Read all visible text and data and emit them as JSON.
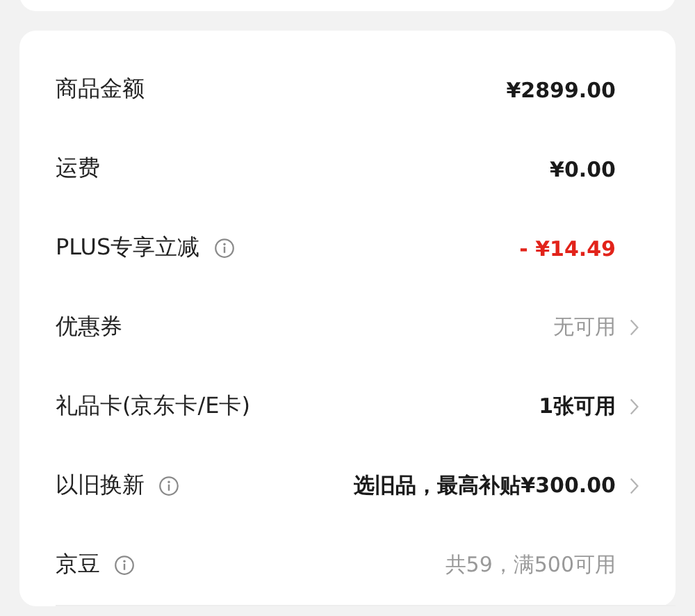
{
  "rows": [
    {
      "label": "商品金额",
      "info": false,
      "value": "¥2899.00",
      "kind": "normal",
      "chevron": false
    },
    {
      "label": "运费",
      "info": false,
      "value": "¥0.00",
      "kind": "normal",
      "chevron": false
    },
    {
      "label": "PLUS专享立减",
      "info": true,
      "value": "- ¥14.49",
      "kind": "discount",
      "chevron": false
    },
    {
      "label": "优惠券",
      "info": false,
      "value": "无可用",
      "kind": "muted",
      "chevron": true
    },
    {
      "label": "礼品卡(京东卡/E卡)",
      "info": false,
      "value": "1张可用",
      "kind": "normal",
      "chevron": true
    },
    {
      "label": "以旧换新",
      "info": true,
      "value": "选旧品，最高补贴¥300.00",
      "kind": "normal",
      "chevron": true
    },
    {
      "label": "京豆",
      "info": true,
      "value": "共59，满500可用",
      "kind": "muted",
      "chevron": false
    }
  ]
}
